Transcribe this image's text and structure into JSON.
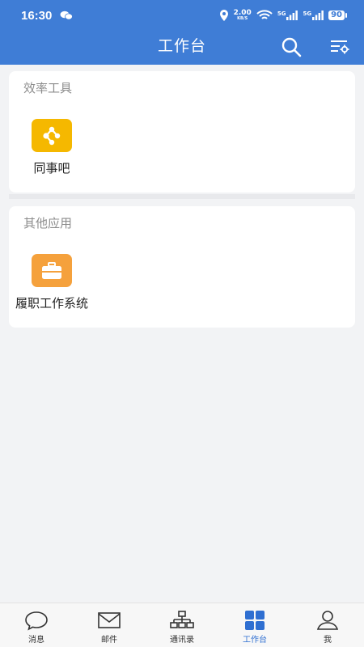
{
  "status_bar": {
    "time": "16:30",
    "net_speed_value": "2.00",
    "net_speed_unit": "KB/S",
    "signal_1": "5G",
    "signal_2": "5G",
    "battery": "90"
  },
  "header": {
    "title": "工作台",
    "background": "#3f7dd6"
  },
  "sections": [
    {
      "title": "效率工具",
      "apps": [
        {
          "label": "同事吧",
          "icon": "share-network-icon",
          "color": "#f5b800"
        }
      ]
    },
    {
      "title": "其他应用",
      "apps": [
        {
          "label": "履职工作系统",
          "icon": "briefcase-icon",
          "color": "#f5a13c"
        }
      ]
    }
  ],
  "bottom_nav": {
    "items": [
      {
        "label": "消息",
        "icon": "chat-bubble-icon"
      },
      {
        "label": "邮件",
        "icon": "mail-icon"
      },
      {
        "label": "通讯录",
        "icon": "org-chart-icon"
      },
      {
        "label": "工作台",
        "icon": "grid-icon",
        "active": true
      },
      {
        "label": "我",
        "icon": "person-icon"
      }
    ],
    "active_color": "#2f6fd1"
  }
}
